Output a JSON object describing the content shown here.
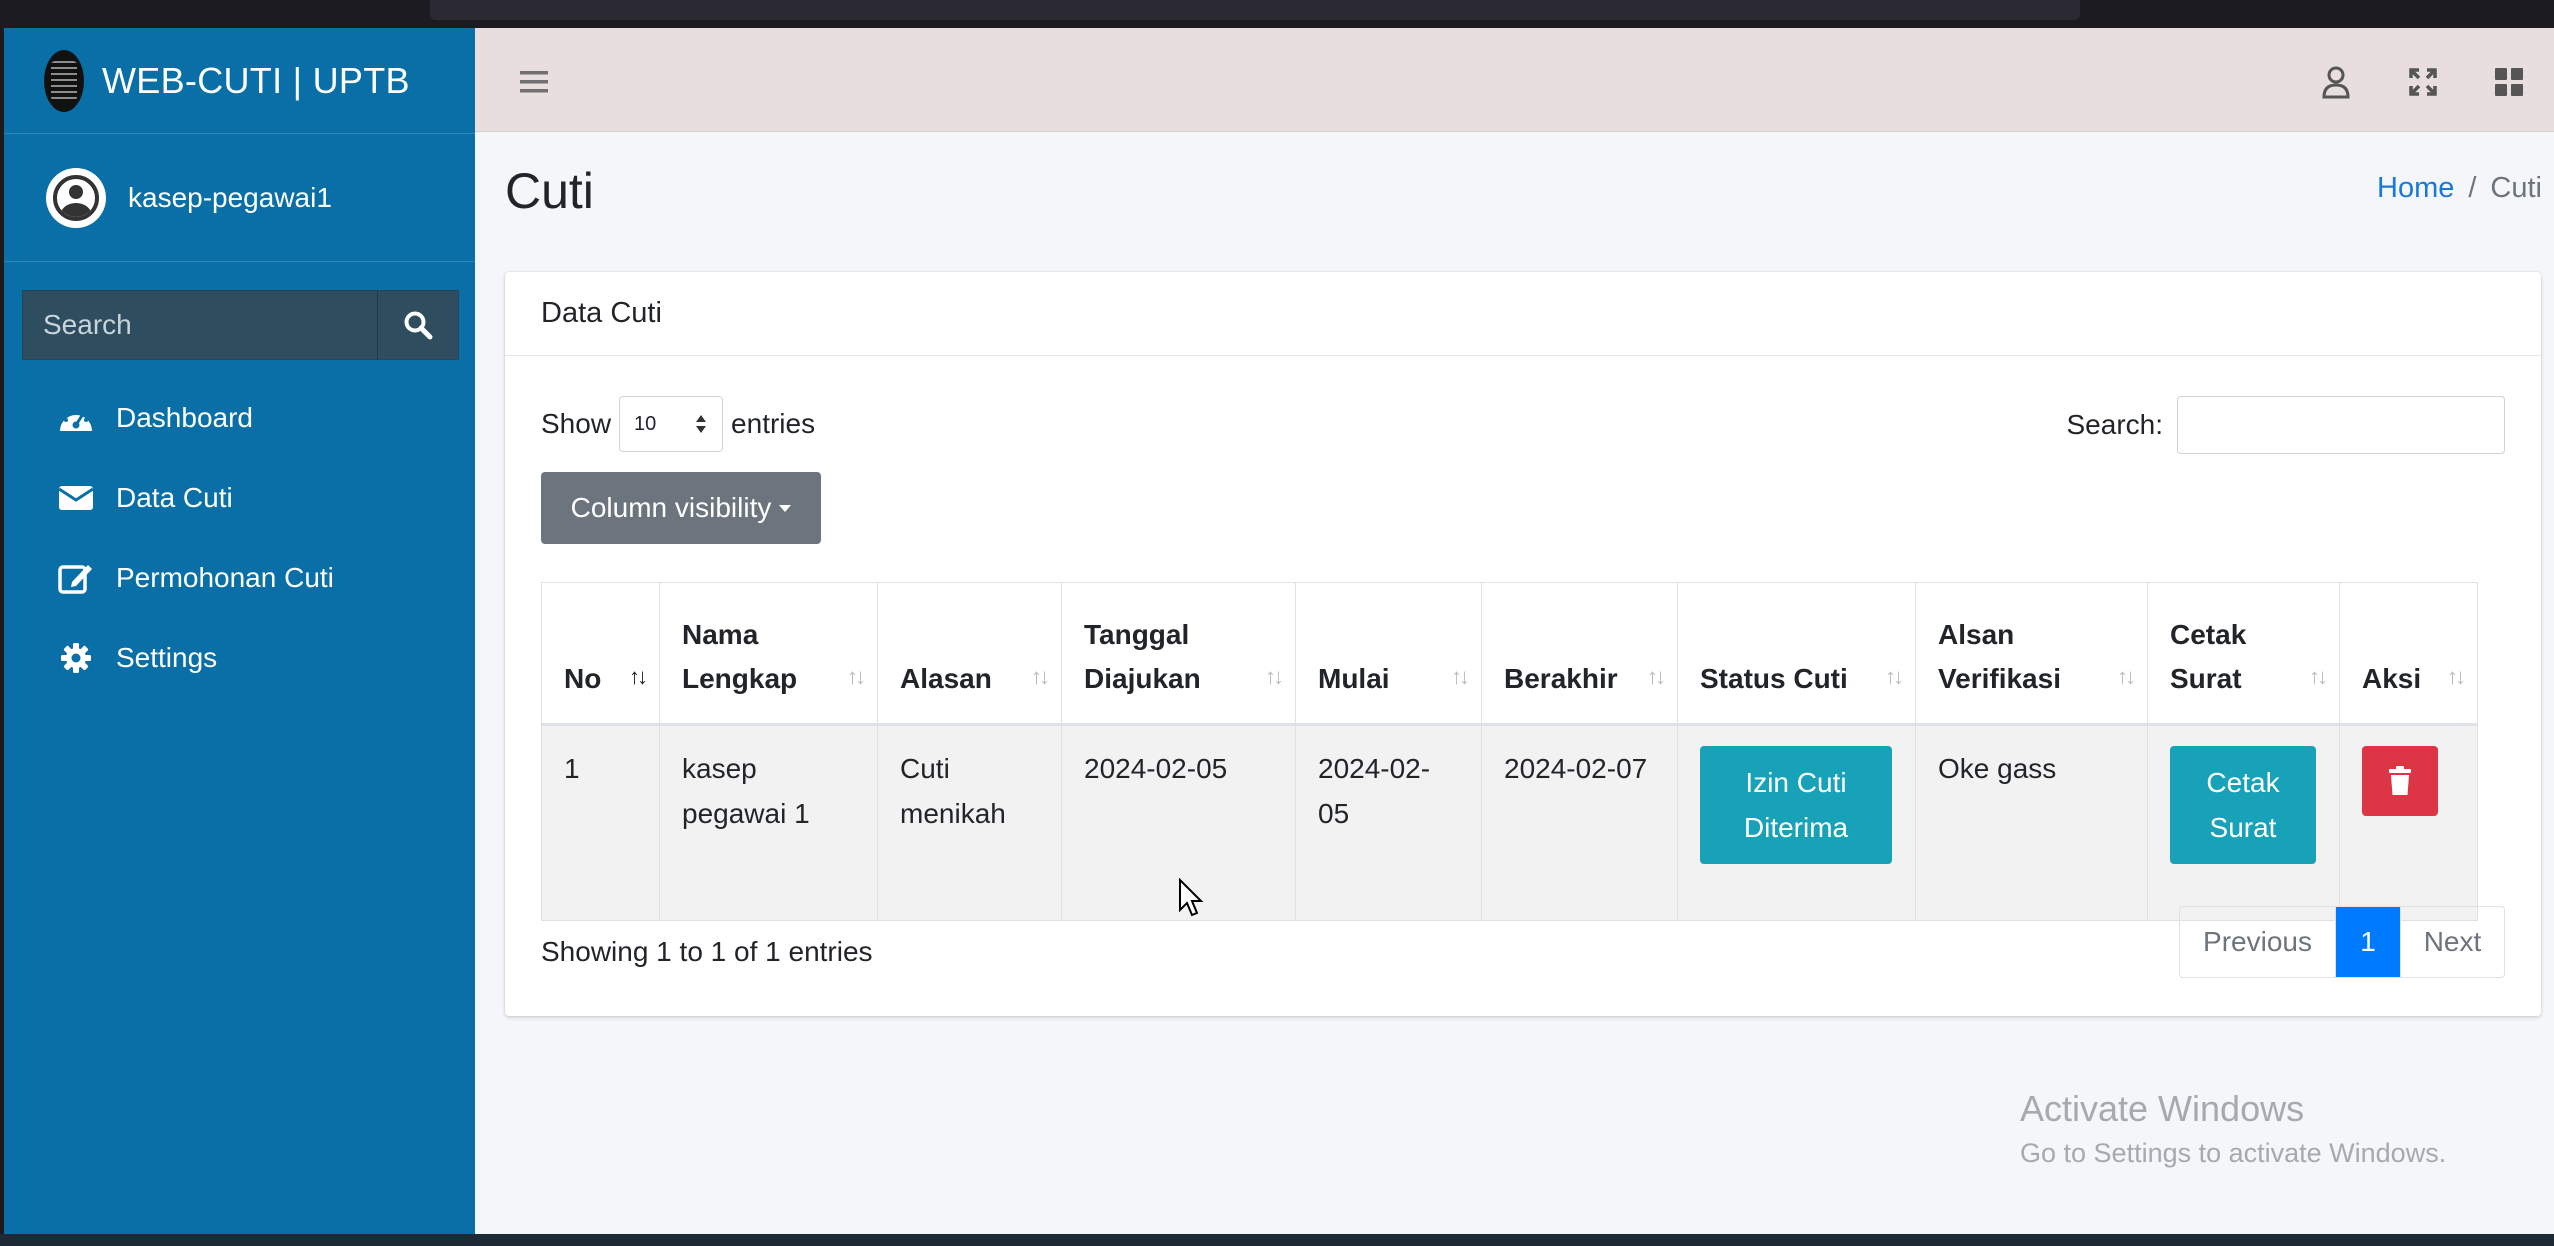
{
  "app": {
    "brand": "WEB-CUTI | UPTB",
    "user": "kasep-pegawai1"
  },
  "sidebar": {
    "search_placeholder": "Search",
    "items": [
      {
        "label": "Dashboard",
        "icon": "tachometer-icon"
      },
      {
        "label": "Data Cuti",
        "icon": "envelope-icon"
      },
      {
        "label": "Permohonan Cuti",
        "icon": "edit-icon"
      },
      {
        "label": "Settings",
        "icon": "gear-icon"
      }
    ]
  },
  "page": {
    "title": "Cuti",
    "breadcrumb": {
      "home": "Home",
      "separator": "/",
      "current": "Cuti"
    }
  },
  "card": {
    "title": "Data Cuti",
    "show_label": "Show",
    "length_value": "10",
    "entries_label": "entries",
    "search_label": "Search:",
    "colvis_label": "Column visibility"
  },
  "table": {
    "headers": [
      [
        "No"
      ],
      [
        "Nama",
        "Lengkap"
      ],
      [
        "Alasan"
      ],
      [
        "Tanggal",
        "Diajukan"
      ],
      [
        "Mulai"
      ],
      [
        "Berakhir"
      ],
      [
        "Status Cuti"
      ],
      [
        "Alsan",
        "Verifikasi"
      ],
      [
        "Cetak",
        "Surat"
      ],
      [
        "Aksi"
      ]
    ],
    "rows": [
      {
        "no": "1",
        "nama": [
          "kasep",
          "pegawai 1"
        ],
        "alasan": [
          "Cuti",
          "menikah"
        ],
        "tanggal": "2024-02-05",
        "mulai": "2024-02-05",
        "berakhir": "2024-02-07",
        "status": [
          "Izin Cuti",
          "Diterima"
        ],
        "verifikasi": "Oke gass",
        "cetak": [
          "Cetak",
          "Surat"
        ]
      }
    ]
  },
  "footer": {
    "info": "Showing 1 to 1 of 1 entries",
    "prev": "Previous",
    "page": "1",
    "next": "Next"
  },
  "watermark": {
    "line1": "Activate Windows",
    "line2": "Go to Settings to activate Windows."
  },
  "colors": {
    "sidebar": "#0a6fa6",
    "info": "#17a2b8",
    "danger": "#dc3545",
    "primary": "#007bff"
  }
}
